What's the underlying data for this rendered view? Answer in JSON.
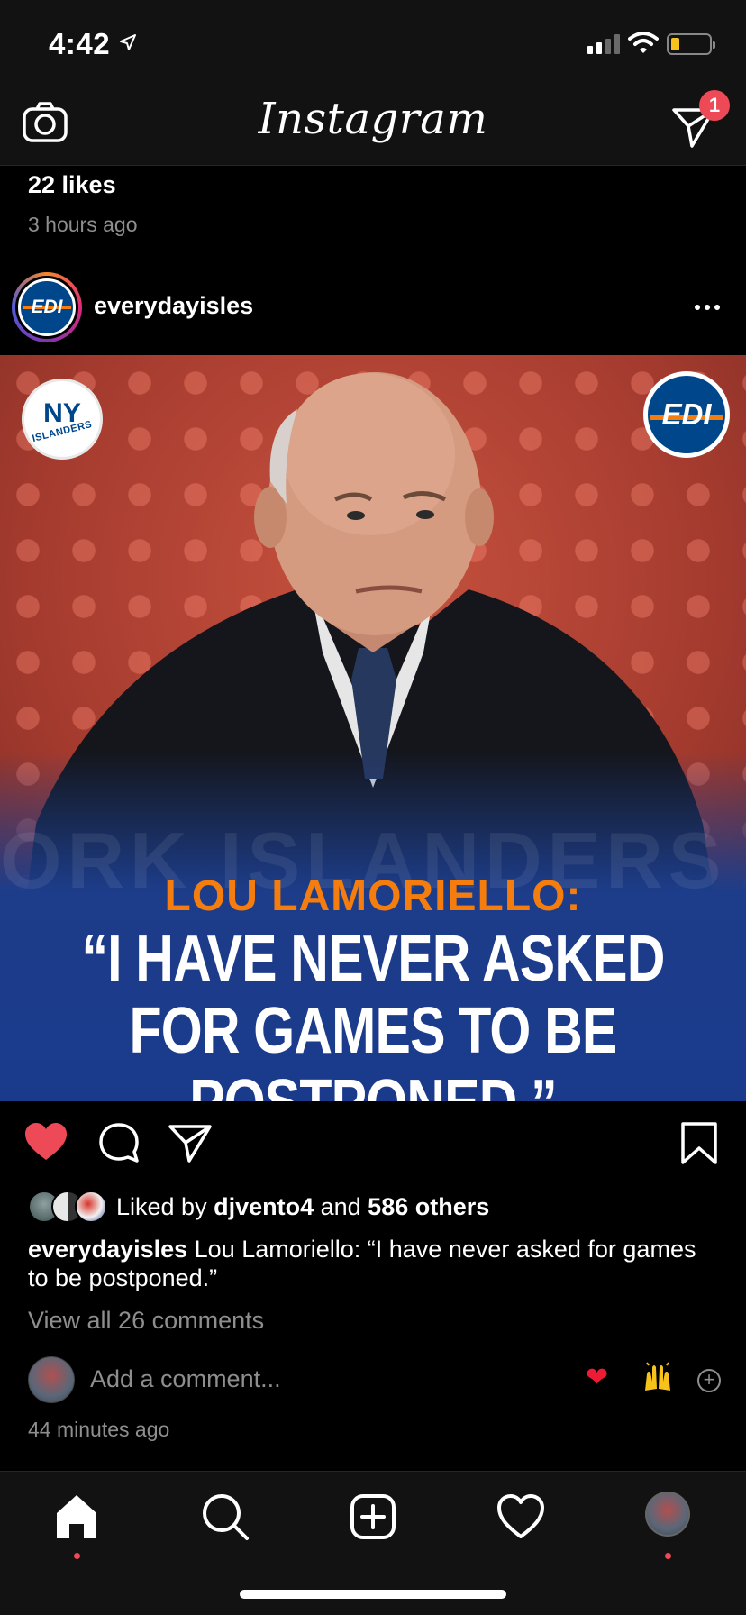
{
  "status_bar": {
    "time": "4:42"
  },
  "top_nav": {
    "logo": "Instagram",
    "dm_badge": "1"
  },
  "previous_post": {
    "likes": "22 likes",
    "time": "3 hours ago"
  },
  "post": {
    "username": "everydayisles",
    "avatar_text": "EDI",
    "image": {
      "left_logo_top": "NY",
      "left_logo_bottom": "ISLANDERS",
      "right_logo": "EDI",
      "headline": "LOU LAMORIELLO:",
      "quote": "“I HAVE NEVER ASKED FOR GAMES TO BE POSTPONED.”",
      "watermark": "ORK ISLANDERS NEW DERS NEW YORK ISLA YOR ISLANDERS NEW"
    },
    "liked_prefix": "Liked by ",
    "liked_user": "djvento4",
    "liked_middle": " and ",
    "liked_others": "586 others",
    "caption_user": "everydayisles",
    "caption_text": " Lou Lamoriello: “I have never asked for games to be postponed.”",
    "view_comments": "View all 26 comments",
    "comment_placeholder": "Add a comment...",
    "emoji_heart": "❤",
    "time": "44 minutes ago"
  }
}
